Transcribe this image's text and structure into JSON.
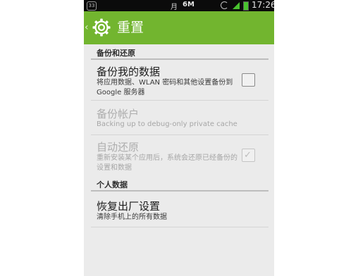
{
  "status_bar": {
    "sim_badge": "33",
    "carrier": "月",
    "network": "6M",
    "time": "17:26"
  },
  "action_bar": {
    "title": "重置"
  },
  "sections": {
    "backup_header": "备份和还原",
    "personal_header": "个人数据"
  },
  "items": {
    "backup_my_data": {
      "title": "备份我的数据",
      "summary": "将应用数据、WLAN 密码和其他设置备份到 Google 服务器",
      "checked": false
    },
    "backup_account": {
      "title": "备份帐户",
      "summary": "Backing up to debug-only private cache"
    },
    "auto_restore": {
      "title": "自动还原",
      "summary": "重新安装某个应用后，系统会还原已经备份的设置和数据",
      "checked": true
    },
    "factory_reset": {
      "title": "恢复出厂设置",
      "summary": "清除手机上的所有数据"
    }
  },
  "colors": {
    "action_bar": "#72b52f",
    "status_bar": "#0b0b0b",
    "background": "#ebebeb"
  }
}
